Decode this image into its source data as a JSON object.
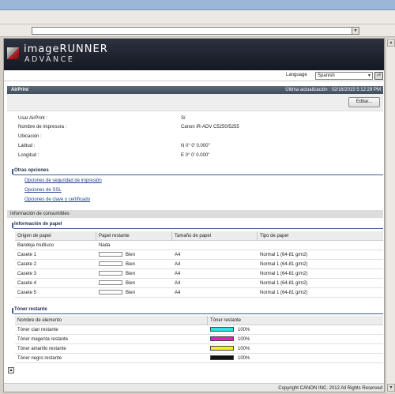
{
  "brand": {
    "name": "imageRUNNER",
    "sub": "ADVANCE"
  },
  "language": {
    "label": "Language",
    "selected": "Spanish"
  },
  "section": {
    "title": "AirPrint",
    "updated": "Última actualización : 02/16/2015 5:12:29 PM"
  },
  "edit_label": "Editar...",
  "settings": [
    {
      "key": "Usar AirPrint :",
      "value": "Sí"
    },
    {
      "key": "Nombre de impresora :",
      "value": "Canon iR-ADV C5250/5255"
    },
    {
      "key": "Ubicación :",
      "value": ""
    },
    {
      "key": "Latitud :",
      "value": "N 0° 0' 0.000\""
    },
    {
      "key": "Longitud :",
      "value": "E 0° 0' 0.000\""
    }
  ],
  "other_options": {
    "title": "Otras opciones",
    "links": [
      "Opciones de seguridad de impresión",
      "Opciones de SSL",
      "Opciones de clave y certificado"
    ]
  },
  "consumables": {
    "title": "Información de consumibles",
    "paper": {
      "title": "Información de papel",
      "headers": [
        "Origen de papel",
        "Papel restante",
        "Tamaño de papel",
        "Tipo de papel"
      ],
      "rows": [
        {
          "source": "Bandeja multiuso",
          "remaining": "Nada",
          "has_bar": false,
          "size": "",
          "type": ""
        },
        {
          "source": "Casete 1",
          "remaining": "Bien",
          "has_bar": true,
          "size": "A4",
          "type": "Normal 1 (64-81 g/m2)"
        },
        {
          "source": "Casete 2",
          "remaining": "Bien",
          "has_bar": true,
          "size": "A4",
          "type": "Normal 1 (64-81 g/m2)"
        },
        {
          "source": "Casete 3",
          "remaining": "Bien",
          "has_bar": true,
          "size": "A4",
          "type": "Normal 1 (64-81 g/m2)"
        },
        {
          "source": "Casete 4",
          "remaining": "Bien",
          "has_bar": true,
          "size": "A4",
          "type": "Normal 1 (64-81 g/m2)"
        },
        {
          "source": "Casete 5",
          "remaining": "Bien",
          "has_bar": true,
          "size": "A4",
          "type": "Normal 1 (64-81 g/m2)"
        }
      ]
    },
    "toner": {
      "title": "Tóner restante",
      "headers": [
        "Nombre de elemento",
        "Tóner restante"
      ],
      "rows": [
        {
          "name": "Tóner cian restante",
          "percent": "100%",
          "color": "#33e0e6"
        },
        {
          "name": "Tóner magenta restante",
          "percent": "100%",
          "color": "#e020c8"
        },
        {
          "name": "Tóner amarillo restante",
          "percent": "100%",
          "color": "#f2f21a"
        },
        {
          "name": "Tóner negro restante",
          "percent": "100%",
          "color": "#111111"
        }
      ]
    }
  },
  "footer": "Copyright CANON INC. 2012 All Rights Reserved"
}
